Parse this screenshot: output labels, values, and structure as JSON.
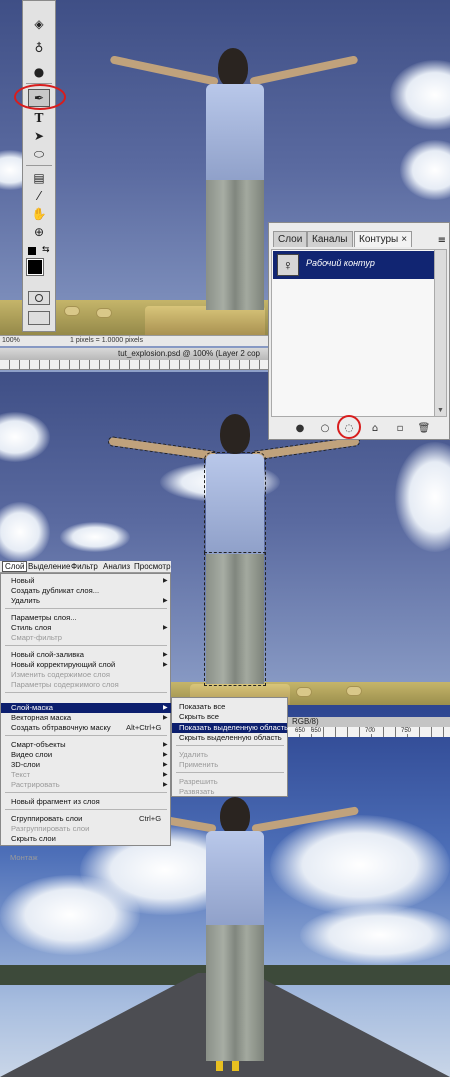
{
  "document": {
    "title": "tut_explosion.psd @ 100% (Layer 2 cop",
    "zoom": "100%",
    "status": "1 pixels = 1.0000 pixels",
    "mode_fragment": "RGB/8)"
  },
  "toolbox": {
    "tools": [
      "paint-bucket-icon",
      "smudge-icon",
      "burn-icon",
      "pen-icon",
      "type-icon",
      "path-select-icon",
      "ellipse-icon",
      "notes-icon",
      "eyedropper-icon",
      "hand-icon",
      "zoom-icon"
    ],
    "selected_tool": "pen-icon"
  },
  "paths_panel": {
    "tabs": [
      "Слои",
      "Каналы",
      "Контуры"
    ],
    "active_tab": "Контуры",
    "close_glyph": "×",
    "path_name": "Рабочий контур",
    "footer_buttons": [
      "fill-path-icon",
      "stroke-path-icon",
      "load-path-as-selection-icon",
      "make-work-path-icon",
      "new-path-icon",
      "delete-path-icon"
    ]
  },
  "menubar": {
    "items": [
      "Слой",
      "Выделение",
      "Фильтр",
      "Анализ",
      "Просмотр"
    ],
    "active": "Слой"
  },
  "layer_menu": {
    "items": [
      {
        "label": "Новый",
        "arrow": true,
        "disabled": false
      },
      {
        "label": "Создать дубликат слоя...",
        "arrow": false,
        "disabled": false
      },
      {
        "label": "Удалить",
        "arrow": true,
        "disabled": false
      },
      {
        "label": "Параметры слоя...",
        "arrow": false,
        "disabled": false
      },
      {
        "label": "Стиль слоя",
        "arrow": true,
        "disabled": false
      },
      {
        "label": "Смарт-фильтр",
        "arrow": false,
        "disabled": true
      },
      {
        "label": "Новый слой-заливка",
        "arrow": true,
        "disabled": false
      },
      {
        "label": "Новый корректирующий слой",
        "arrow": true,
        "disabled": false
      },
      {
        "label": "Изменить содержимое слоя",
        "arrow": false,
        "disabled": true
      },
      {
        "label": "Параметры содержимого слоя",
        "arrow": false,
        "disabled": true
      },
      {
        "label": "Слой-маска",
        "arrow": true,
        "disabled": false
      },
      {
        "label": "Векторная маска",
        "arrow": true,
        "disabled": false
      },
      {
        "label": "Создать обтравочную маску",
        "arrow": false,
        "disabled": false,
        "shortcut": "Alt+Ctrl+G"
      },
      {
        "label": "Смарт-объекты",
        "arrow": true,
        "disabled": false
      },
      {
        "label": "Видео слои",
        "arrow": true,
        "disabled": false
      },
      {
        "label": "3D-слои",
        "arrow": true,
        "disabled": false
      },
      {
        "label": "Текст",
        "arrow": true,
        "disabled": true
      },
      {
        "label": "Растрировать",
        "arrow": true,
        "disabled": true
      },
      {
        "label": "Новый фрагмент из слоя",
        "arrow": false,
        "disabled": false
      },
      {
        "label": "Сгруппировать слои",
        "arrow": false,
        "disabled": false,
        "shortcut": "Ctrl+G"
      },
      {
        "label": "Разгруппировать слои",
        "arrow": false,
        "disabled": true
      },
      {
        "label": "Скрыть слои",
        "arrow": false,
        "disabled": false
      },
      {
        "label": "Монтаж",
        "arrow": false,
        "disabled": true
      }
    ]
  },
  "mask_submenu": {
    "items": [
      {
        "label": "Показать все",
        "disabled": false
      },
      {
        "label": "Скрыть все",
        "disabled": false
      },
      {
        "label": "Показать выделенную область",
        "disabled": false,
        "highlighted": true
      },
      {
        "label": "Скрыть выделенную область",
        "disabled": false
      },
      {
        "label": "Удалить",
        "disabled": true
      },
      {
        "label": "Применить",
        "disabled": true
      },
      {
        "label": "Разрешить",
        "disabled": true
      },
      {
        "label": "Развязать",
        "disabled": true
      }
    ]
  },
  "ruler_labels": [
    "650",
    "650",
    "700",
    "750"
  ],
  "colors": {
    "menu_highlight": "#0c1f6e",
    "annotation_ring": "#d81d1d"
  }
}
